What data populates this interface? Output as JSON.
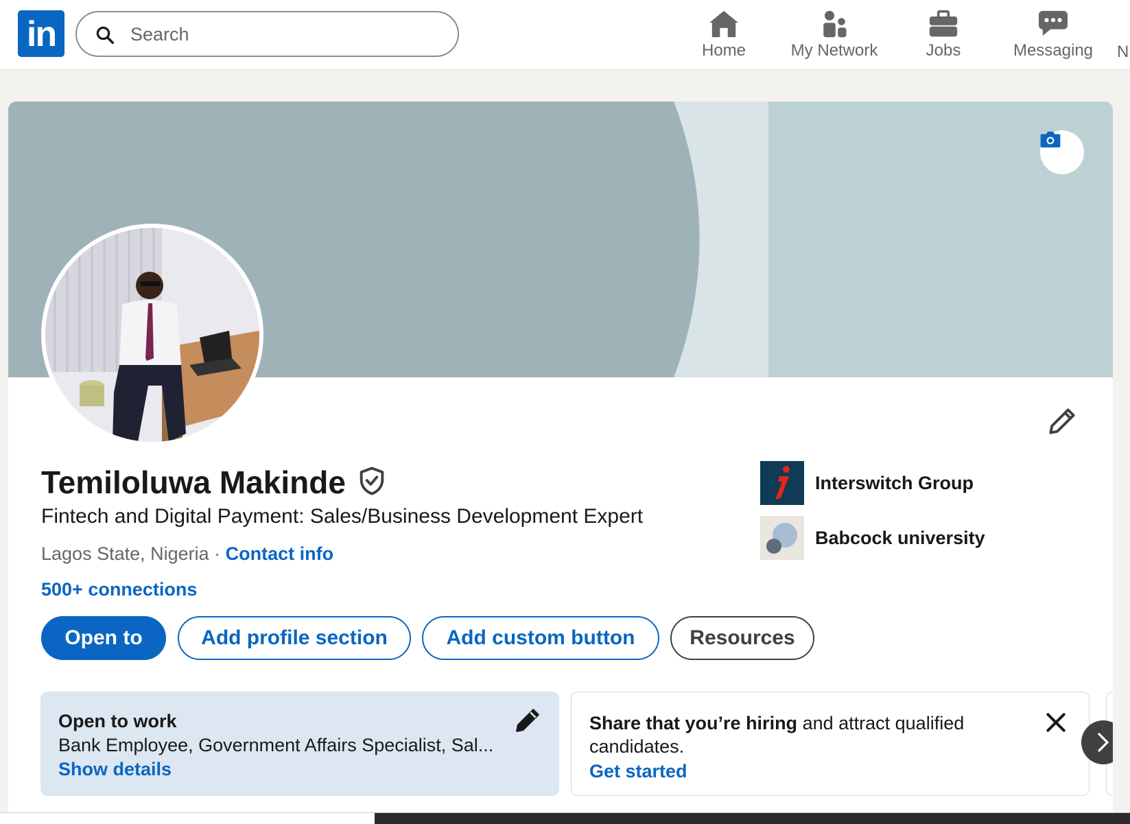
{
  "nav": {
    "search_placeholder": "Search",
    "items": [
      {
        "label": "Home",
        "icon": "home-icon"
      },
      {
        "label": "My Network",
        "icon": "network-icon"
      },
      {
        "label": "Jobs",
        "icon": "jobs-icon"
      },
      {
        "label": "Messaging",
        "icon": "messaging-icon"
      }
    ],
    "cut_label": "N"
  },
  "profile": {
    "name": "Temiloluwa Makinde",
    "headline": "Fintech and Digital Payment: Sales/Business Development Expert",
    "location": "Lagos State, Nigeria",
    "separator": " · ",
    "contact_info": "Contact info",
    "connections": "500+ connections",
    "organizations": [
      {
        "name": "Interswitch Group"
      },
      {
        "name": "Babcock university"
      }
    ]
  },
  "actions": {
    "open_to": "Open to",
    "add_profile_section": "Add profile section",
    "add_custom_button": "Add custom button",
    "resources": "Resources"
  },
  "open_to_work": {
    "title": "Open to work",
    "details": "Bank Employee, Government Affairs Specialist, Sal...",
    "link": "Show details"
  },
  "hiring": {
    "bold": "Share that you’re hiring",
    "rest": " and attract qualified candidates.",
    "link": "Get started"
  },
  "colors": {
    "brand": "#0a66c2",
    "cover_main": "#9fb2b7",
    "cover_light": "#bdd1d5",
    "open_to_work_bg": "#dde7f1"
  }
}
